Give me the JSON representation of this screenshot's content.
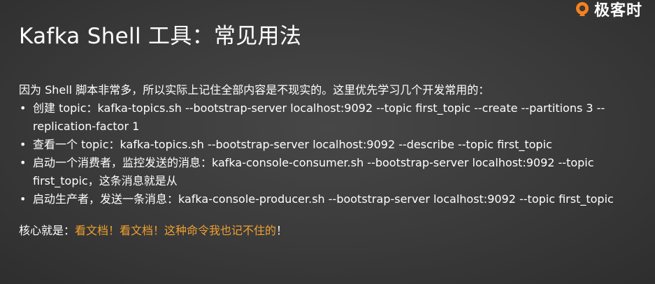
{
  "brand": {
    "logo_text": "极客时",
    "logo_icon": "geektime-logo-icon",
    "accent_color": "#f5811f"
  },
  "slide": {
    "title": "Kafka  Shell 工具：常见用法",
    "intro": "因为 Shell 脚本非常多，所以实际上记住全部内容是不现实的。这里优先学习几个开发常用的：",
    "bullet_symbol": "•",
    "bullets": [
      {
        "text": "创建 topic：kafka-topics.sh --bootstrap-server localhost:9092 --topic first_topic --create --partitions 3 --replication-factor 1"
      },
      {
        "text": "查看一个 topic：kafka-topics.sh --bootstrap-server localhost:9092 --describe --topic first_topic"
      },
      {
        "text": "启动一个消费者，监控发送的消息：kafka-console-consumer.sh --bootstrap-server localhost:9092 --topic first_topic，这条消息就是从"
      },
      {
        "text": "启动生产者，发送一条消息：kafka-console-producer.sh --bootstrap-server localhost:9092 --topic first_topic"
      }
    ],
    "conclusion_prefix": "核心就是：",
    "conclusion_highlight": "看文档！看文档！这种命令我也记不住的",
    "conclusion_suffix": "！",
    "highlight_color": "#f0a030"
  }
}
